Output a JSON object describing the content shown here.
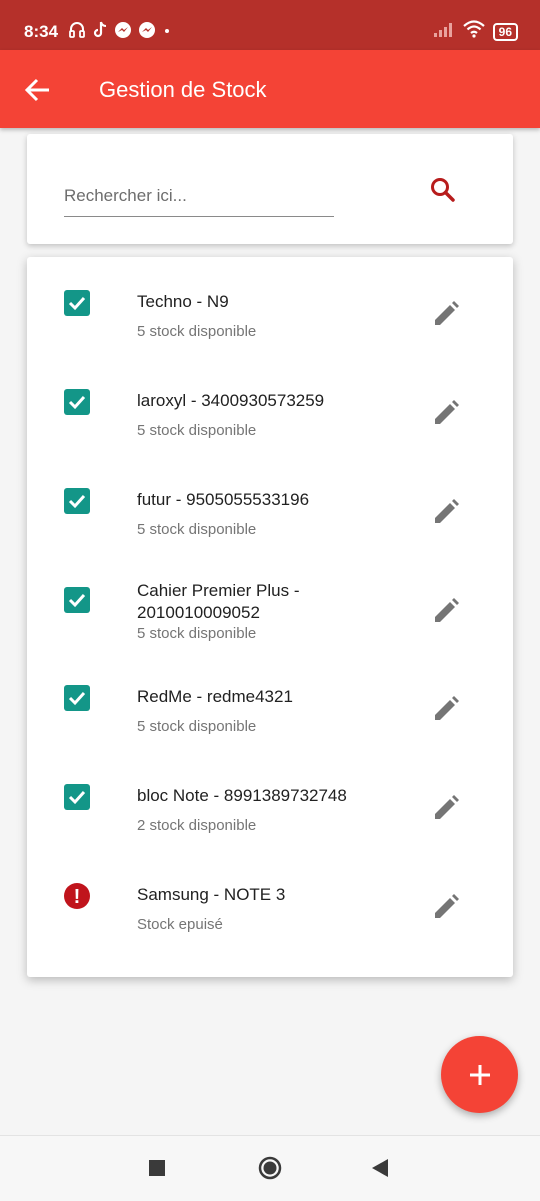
{
  "status_bar": {
    "time": "8:34",
    "battery": "96",
    "icons": [
      "headset-icon",
      "tiktok-icon",
      "messenger-icon",
      "messenger-icon",
      "dot-icon",
      "signal-icon",
      "wifi-icon",
      "battery-icon"
    ]
  },
  "app_bar": {
    "title": "Gestion de Stock",
    "back_icon": "arrow-back-icon",
    "color": "#f44336"
  },
  "search": {
    "placeholder": "Rechercher ici...",
    "value": "",
    "icon": "search-icon",
    "icon_color": "#b71c1c"
  },
  "items": [
    {
      "name": "Techno - N9",
      "stock": "5 stock disponible",
      "status": "available"
    },
    {
      "name": "laroxyl - 3400930573259",
      "stock": "5 stock disponible",
      "status": "available"
    },
    {
      "name": "futur  - 9505055533196",
      "stock": "5 stock disponible",
      "status": "available"
    },
    {
      "name": "Cahier Premier Plus - 2010010009052",
      "stock": "5 stock disponible",
      "status": "available"
    },
    {
      "name": "RedMe - redme4321",
      "stock": "5 stock disponible",
      "status": "available"
    },
    {
      "name": "bloc Note - 8991389732748",
      "stock": "2 stock disponible",
      "status": "available"
    },
    {
      "name": "Samsung - NOTE 3",
      "stock": "Stock epuisé",
      "status": "out_of_stock"
    }
  ],
  "colors": {
    "check": "#139688",
    "error": "#c0141c",
    "edit_icon": "#757575",
    "fab": "#f44336"
  },
  "fab": {
    "icon": "plus-icon"
  },
  "nav_bar": {
    "icons": [
      "recent-apps-icon",
      "home-icon",
      "back-icon"
    ]
  }
}
